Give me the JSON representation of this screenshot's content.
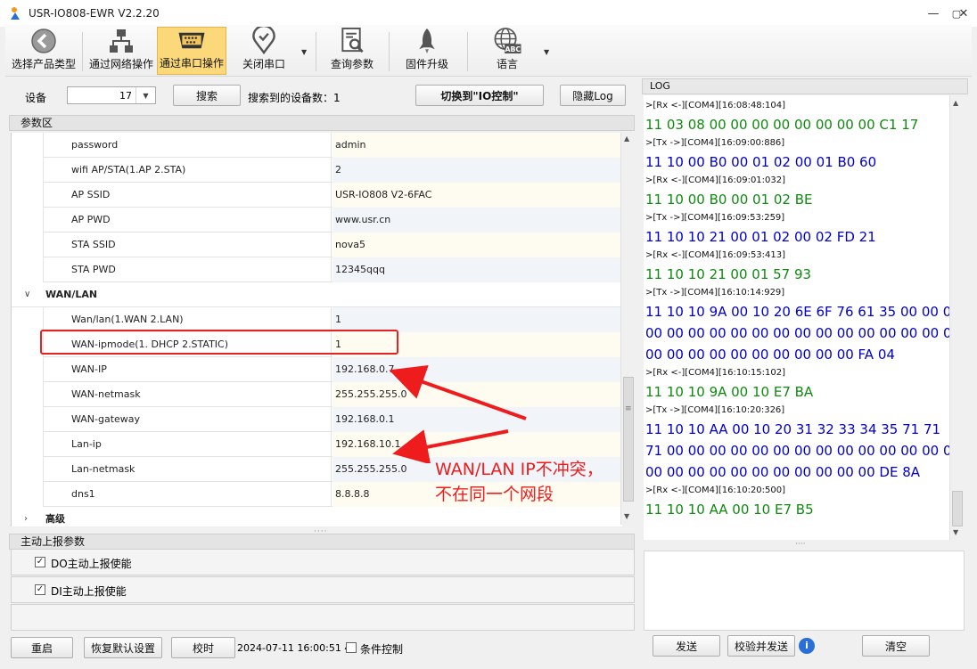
{
  "window": {
    "title": "USR-IO808-EWR V2.2.20",
    "minimize": "—",
    "maximize": "▢",
    "close": "✕"
  },
  "toolbar": {
    "items": [
      {
        "label": "选择产品类型",
        "icon": "back-arrow-icon"
      },
      {
        "label": "通过网络操作",
        "icon": "network-icon"
      },
      {
        "label": "通过串口操作",
        "icon": "serial-port-icon",
        "active": true
      },
      {
        "label": "关闭串口",
        "icon": "location-pin-icon"
      },
      {
        "label": "查询参数",
        "icon": "query-doc-icon"
      },
      {
        "label": "固件升级",
        "icon": "rocket-icon"
      },
      {
        "label": "语言",
        "icon": "globe-abc-icon"
      }
    ],
    "globe_badge": "ABC"
  },
  "device_bar": {
    "device_label": "设备",
    "device_value": "17",
    "search_button": "搜索",
    "found_label": "搜索到的设备数：1",
    "switch_button": "切换到\"IO控制\"",
    "hide_log_button": "隐藏Log"
  },
  "params": {
    "header": "参数区",
    "rows": [
      {
        "name": "password",
        "value": "admin"
      },
      {
        "name": "wifi AP/STA(1.AP 2.STA)",
        "value": "2"
      },
      {
        "name": "AP SSID",
        "value": "USR-IO808 V2-6FAC"
      },
      {
        "name": "AP PWD",
        "value": "www.usr.cn"
      },
      {
        "name": "STA SSID",
        "value": "nova5"
      },
      {
        "name": "STA PWD",
        "value": "12345qqq"
      }
    ],
    "wan_category": "WAN/LAN",
    "wan_rows": [
      {
        "name": "Wan/lan(1.WAN 2.LAN)",
        "value": "1"
      },
      {
        "name": "WAN-ipmode(1. DHCP 2.STATIC)",
        "value": "1"
      },
      {
        "name": "WAN-IP",
        "value": "192.168.0.7"
      },
      {
        "name": "WAN-netmask",
        "value": "255.255.255.0"
      },
      {
        "name": "WAN-gateway",
        "value": "192.168.0.1"
      },
      {
        "name": "Lan-ip",
        "value": "192.168.10.1"
      },
      {
        "name": "Lan-netmask",
        "value": "255.255.255.0"
      },
      {
        "name": "dns1",
        "value": "8.8.8.8"
      }
    ],
    "advanced_category": "高级"
  },
  "annotation": {
    "line1": "WAN/LAN  IP不冲突，",
    "line2": "不在同一个网段"
  },
  "report": {
    "header": "主动上报参数",
    "do_label": "DO主动上报使能",
    "di_label": "DI主动上报使能",
    "check": "✓"
  },
  "bottom": {
    "restart": "重启",
    "restore": "恢复默认设置",
    "timesync": "校时",
    "datetime": "2024-07-11 16:00:51 4",
    "condition": "条件控制"
  },
  "log": {
    "header": "LOG",
    "lines": [
      {
        "kind": "meta",
        "text": ">[Rx <-][COM4][16:08:48:104]"
      },
      {
        "kind": "rx",
        "text": "11 03 08 00 00 00 00 00 00 00 00 C1 17"
      },
      {
        "kind": "meta",
        "text": ">[Tx ->][COM4][16:09:00:886]"
      },
      {
        "kind": "tx",
        "text": "11 10 00 B0 00 01 02 00 01 B0 60"
      },
      {
        "kind": "meta",
        "text": ">[Rx <-][COM4][16:09:01:032]"
      },
      {
        "kind": "rx",
        "text": "11 10 00 B0 00 01 02 BE"
      },
      {
        "kind": "meta",
        "text": ">[Tx ->][COM4][16:09:53:259]"
      },
      {
        "kind": "tx",
        "text": "11 10 10 21 00 01 02 00 02 FD 21"
      },
      {
        "kind": "meta",
        "text": ">[Rx <-][COM4][16:09:53:413]"
      },
      {
        "kind": "rx",
        "text": "11 10 10 21 00 01 57 93"
      },
      {
        "kind": "meta",
        "text": ">[Tx ->][COM4][16:10:14:929]"
      },
      {
        "kind": "tx",
        "text": "11 10 10 9A 00 10 20 6E 6F 76 61 35 00 00 00"
      },
      {
        "kind": "tx",
        "text": "00 00 00 00 00 00 00 00 00 00 00 00 00 00 00"
      },
      {
        "kind": "tx",
        "text": "00 00 00 00 00 00 00 00 00 00 FA 04"
      },
      {
        "kind": "meta",
        "text": ">[Rx <-][COM4][16:10:15:102]"
      },
      {
        "kind": "rx",
        "text": "11 10 10 9A 00 10 E7 BA"
      },
      {
        "kind": "meta",
        "text": ">[Tx ->][COM4][16:10:20:326]"
      },
      {
        "kind": "tx",
        "text": "11 10 10 AA 00 10 20 31 32 33 34 35 71 71"
      },
      {
        "kind": "tx",
        "text": "71 00 00 00 00 00 00 00 00 00 00 00 00 00 00"
      },
      {
        "kind": "tx",
        "text": "00 00 00 00 00 00 00 00 00 00 00 DE 8A"
      },
      {
        "kind": "meta",
        "text": ">[Rx <-][COM4][16:10:20:500]"
      },
      {
        "kind": "rx",
        "text": "11 10 10 AA 00 10 E7 B5"
      }
    ],
    "send": "发送",
    "verify_send": "校验并发送",
    "info_icon": "i",
    "clear": "清空"
  },
  "colors": {
    "rx": "#0f8a0f",
    "tx": "#0000cc",
    "accent_active": "#fbd87a",
    "annotation": "#ee1c1c"
  }
}
